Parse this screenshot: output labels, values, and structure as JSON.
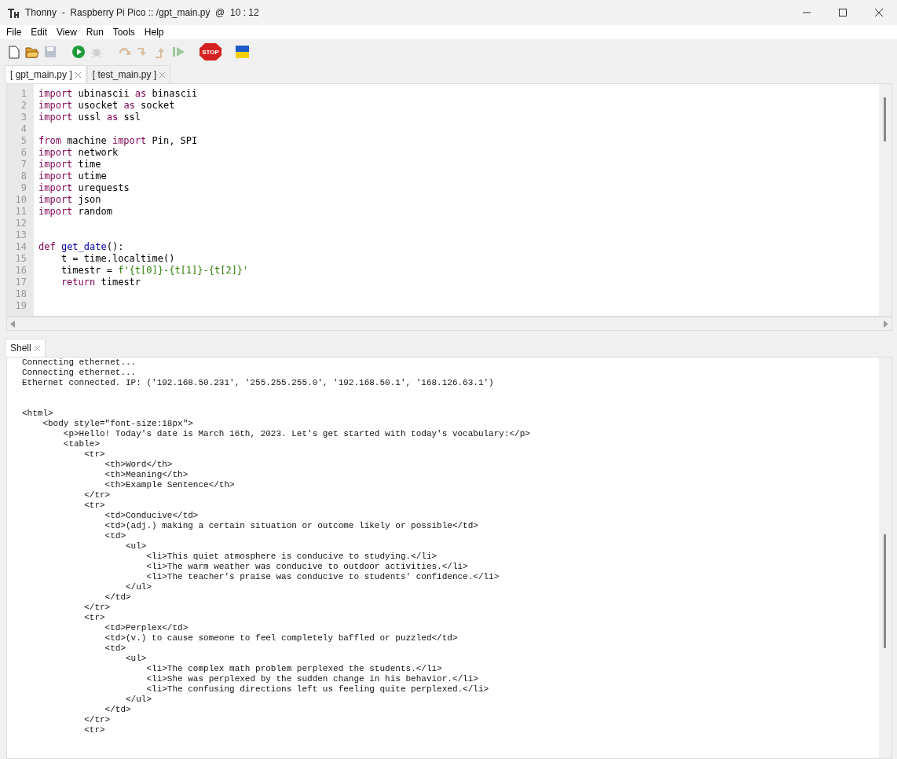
{
  "window": {
    "title": "Thonny  -  Raspberry Pi Pico :: /gpt_main.py  @  10 : 12"
  },
  "menu": [
    "File",
    "Edit",
    "View",
    "Run",
    "Tools",
    "Help"
  ],
  "toolbar": [
    {
      "kind": "new",
      "disabled": false
    },
    {
      "kind": "open",
      "disabled": false
    },
    {
      "kind": "save",
      "disabled": true
    },
    {
      "kind": "gap"
    },
    {
      "kind": "run",
      "disabled": false
    },
    {
      "kind": "debug",
      "disabled": true
    },
    {
      "kind": "gap"
    },
    {
      "kind": "step_over",
      "disabled": true
    },
    {
      "kind": "step_into",
      "disabled": true
    },
    {
      "kind": "step_out",
      "disabled": true
    },
    {
      "kind": "resume",
      "disabled": true
    },
    {
      "kind": "gap"
    },
    {
      "kind": "stop",
      "disabled": false,
      "label": "STOP"
    },
    {
      "kind": "gap"
    },
    {
      "kind": "flag",
      "disabled": false
    }
  ],
  "editor_tabs": [
    {
      "label": "[ gpt_main.py ]",
      "selected": true
    },
    {
      "label": "[ test_main.py ]",
      "selected": false
    }
  ],
  "editor": {
    "lines": [
      {
        "number": "1",
        "tokens": [
          {
            "kind": "keyword",
            "text": "import "
          },
          {
            "kind": "plain",
            "text": "ubinascii "
          },
          {
            "kind": "keyword",
            "text": "as "
          },
          {
            "kind": "plain",
            "text": "binascii"
          }
        ]
      },
      {
        "number": "2",
        "tokens": [
          {
            "kind": "keyword",
            "text": "import "
          },
          {
            "kind": "plain",
            "text": "usocket "
          },
          {
            "kind": "keyword",
            "text": "as "
          },
          {
            "kind": "plain",
            "text": "socket"
          }
        ]
      },
      {
        "number": "3",
        "tokens": [
          {
            "kind": "keyword",
            "text": "import "
          },
          {
            "kind": "plain",
            "text": "ussl "
          },
          {
            "kind": "keyword",
            "text": "as "
          },
          {
            "kind": "plain",
            "text": "ssl"
          }
        ]
      },
      {
        "number": "4"
      },
      {
        "number": "5",
        "tokens": [
          {
            "kind": "keyword",
            "text": "from "
          },
          {
            "kind": "plain",
            "text": "machine "
          },
          {
            "kind": "keyword",
            "text": "import "
          },
          {
            "kind": "plain",
            "text": "Pin, SPI"
          }
        ]
      },
      {
        "number": "6",
        "tokens": [
          {
            "kind": "keyword",
            "text": "import "
          },
          {
            "kind": "plain",
            "text": "network"
          }
        ]
      },
      {
        "number": "7",
        "tokens": [
          {
            "kind": "keyword",
            "text": "import "
          },
          {
            "kind": "plain",
            "text": "time"
          }
        ]
      },
      {
        "number": "8",
        "tokens": [
          {
            "kind": "keyword",
            "text": "import "
          },
          {
            "kind": "plain",
            "text": "utime"
          }
        ]
      },
      {
        "number": "9",
        "tokens": [
          {
            "kind": "keyword",
            "text": "import "
          },
          {
            "kind": "plain",
            "text": "urequests"
          }
        ]
      },
      {
        "number": "10",
        "tokens": [
          {
            "kind": "keyword",
            "text": "import "
          },
          {
            "kind": "plain",
            "text": "json"
          }
        ]
      },
      {
        "number": "11",
        "tokens": [
          {
            "kind": "keyword",
            "text": "import "
          },
          {
            "kind": "plain",
            "text": "random"
          }
        ]
      },
      {
        "number": "12"
      },
      {
        "number": "13"
      },
      {
        "number": "14",
        "tokens": [
          {
            "kind": "keyword",
            "text": "def "
          },
          {
            "kind": "function",
            "text": "get_date"
          },
          {
            "kind": "plain",
            "text": "():"
          }
        ]
      },
      {
        "number": "15",
        "tokens": [
          {
            "kind": "plain",
            "text": "    t = time.localtime()"
          }
        ]
      },
      {
        "number": "16",
        "tokens": [
          {
            "kind": "plain",
            "text": "    timestr = "
          },
          {
            "kind": "string",
            "text": "f'{t[0]}-{t[1]}-{t[2]}'"
          }
        ]
      },
      {
        "number": "17",
        "tokens": [
          {
            "kind": "keyword",
            "text": "    return "
          },
          {
            "kind": "plain",
            "text": "timestr"
          }
        ]
      },
      {
        "number": "18"
      },
      {
        "number": "19"
      }
    ]
  },
  "shell": {
    "tab": {
      "label": "Shell",
      "selected": true
    },
    "lines": [
      {
        "kind": "text",
        "text": "Connecting ethernet..."
      },
      {
        "kind": "text",
        "text": "Connecting ethernet..."
      },
      {
        "kind": "text",
        "text": "Ethernet connected. IP: ('192.168.50.231', '255.255.255.0', '192.168.50.1', '168.126.63.1')"
      },
      {
        "kind": "blank"
      },
      {
        "kind": "blank"
      },
      {
        "kind": "text",
        "text": "<html>"
      },
      {
        "kind": "text",
        "text": "    <body style=\"font-size:18px\">"
      },
      {
        "kind": "text",
        "text": "        <p>Hello! Today's date is March 16th, 2023. Let's get started with today's vocabulary:</p>"
      },
      {
        "kind": "text",
        "text": "        <table>"
      },
      {
        "kind": "text",
        "text": "            <tr>"
      },
      {
        "kind": "text",
        "text": "                <th>Word</th>"
      },
      {
        "kind": "text",
        "text": "                <th>Meaning</th>"
      },
      {
        "kind": "text",
        "text": "                <th>Example Sentence</th>"
      },
      {
        "kind": "text",
        "text": "            </tr>"
      },
      {
        "kind": "text",
        "text": "            <tr>"
      },
      {
        "kind": "text",
        "text": "                <td>Conducive</td>"
      },
      {
        "kind": "text",
        "text": "                <td>(adj.) making a certain situation or outcome likely or possible</td>"
      },
      {
        "kind": "text",
        "text": "                <td>"
      },
      {
        "kind": "text",
        "text": "                    <ul>"
      },
      {
        "kind": "text",
        "text": "                        <li>This quiet atmosphere is conducive to studying.</li>"
      },
      {
        "kind": "text",
        "text": "                        <li>The warm weather was conducive to outdoor activities.</li>"
      },
      {
        "kind": "text",
        "text": "                        <li>The teacher's praise was conducive to students' confidence.</li>"
      },
      {
        "kind": "text",
        "text": "                    </ul>"
      },
      {
        "kind": "text",
        "text": "                </td>"
      },
      {
        "kind": "text",
        "text": "            </tr>"
      },
      {
        "kind": "text",
        "text": "            <tr>"
      },
      {
        "kind": "text",
        "text": "                <td>Perplex</td>"
      },
      {
        "kind": "text",
        "text": "                <td>(v.) to cause someone to feel completely baffled or puzzled</td>"
      },
      {
        "kind": "text",
        "text": "                <td>"
      },
      {
        "kind": "text",
        "text": "                    <ul>"
      },
      {
        "kind": "text",
        "text": "                        <li>The complex math problem perplexed the students.</li>"
      },
      {
        "kind": "text",
        "text": "                        <li>She was perplexed by the sudden change in his behavior.</li>"
      },
      {
        "kind": "text",
        "text": "                        <li>The confusing directions left us feeling quite perplexed.</li>"
      },
      {
        "kind": "text",
        "text": "                    </ul>"
      },
      {
        "kind": "text",
        "text": "                </td>"
      },
      {
        "kind": "text",
        "text": "            </tr>"
      },
      {
        "kind": "text",
        "text": "            <tr>"
      }
    ]
  }
}
